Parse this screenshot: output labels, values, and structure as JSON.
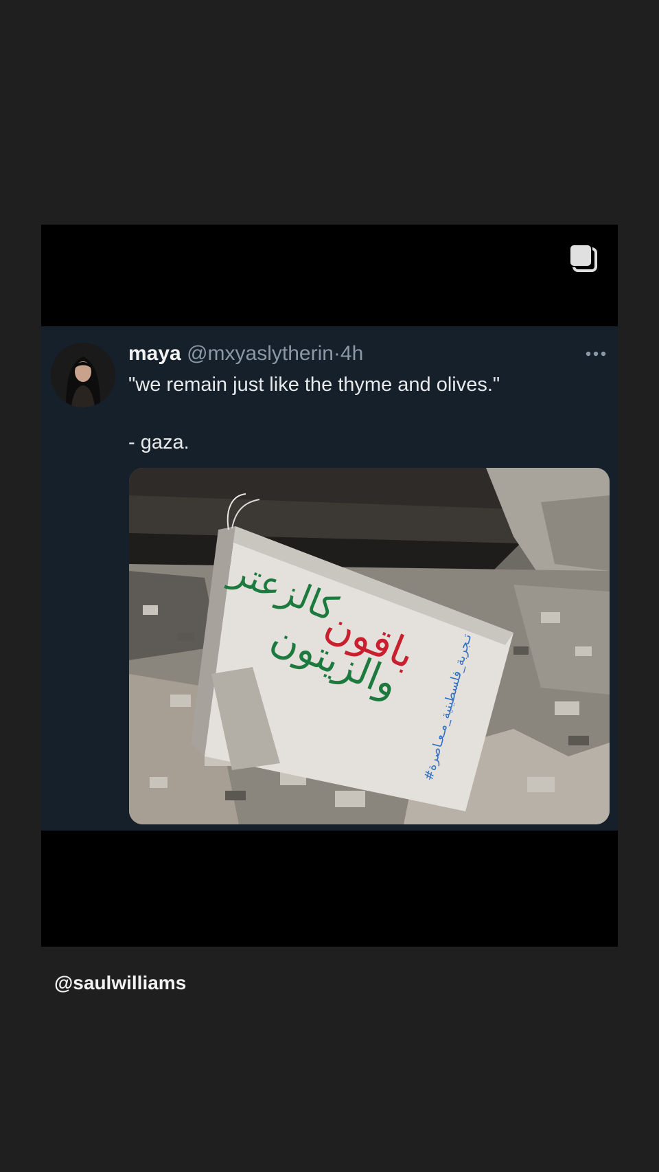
{
  "post": {
    "carousel_icon": "multiple-pages-icon"
  },
  "tweet": {
    "display_name": "maya",
    "handle": "@mxyaslytherin",
    "separator": "·",
    "time": "4h",
    "more_icon": "more-horizontal-icon",
    "text_line_1": "\"we remain just like the thyme and olives.\"",
    "text_line_2": "- gaza.",
    "media": {
      "arabic_line_1_red": "باقون",
      "arabic_line_1_green": "كالزعتر",
      "arabic_line_2_green": "والزيتون",
      "hashtag_blue": "#تـجربة_فلسطينية_مـعـاصرة"
    }
  },
  "credit": {
    "handle": "@saulwilliams"
  },
  "colors": {
    "background": "#1f1f1f",
    "card": "#000000",
    "tweet_bg": "#15202b",
    "muted_text": "#8b98a5",
    "graffiti_green": "#1c7a3e",
    "graffiti_red": "#c8202e",
    "graffiti_blue": "#2f6fc4"
  }
}
